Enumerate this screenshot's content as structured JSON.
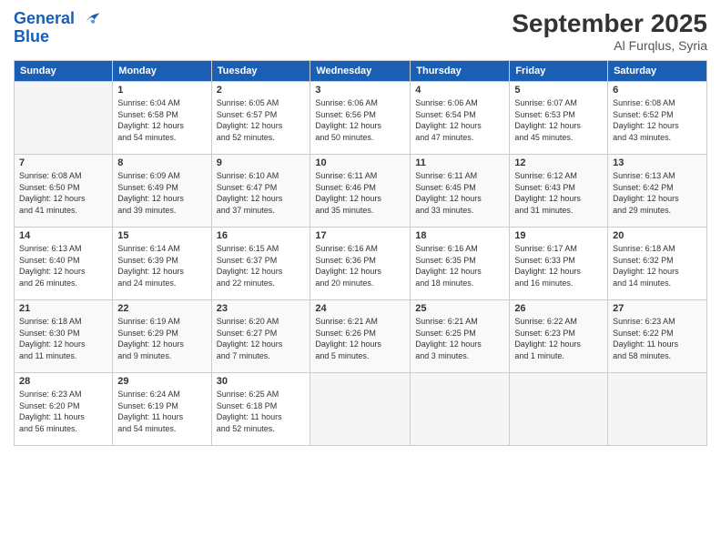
{
  "header": {
    "logo_line1": "General",
    "logo_line2": "Blue",
    "month": "September 2025",
    "location": "Al Furqlus, Syria"
  },
  "weekdays": [
    "Sunday",
    "Monday",
    "Tuesday",
    "Wednesday",
    "Thursday",
    "Friday",
    "Saturday"
  ],
  "weeks": [
    [
      {
        "day": "",
        "info": ""
      },
      {
        "day": "1",
        "info": "Sunrise: 6:04 AM\nSunset: 6:58 PM\nDaylight: 12 hours\nand 54 minutes."
      },
      {
        "day": "2",
        "info": "Sunrise: 6:05 AM\nSunset: 6:57 PM\nDaylight: 12 hours\nand 52 minutes."
      },
      {
        "day": "3",
        "info": "Sunrise: 6:06 AM\nSunset: 6:56 PM\nDaylight: 12 hours\nand 50 minutes."
      },
      {
        "day": "4",
        "info": "Sunrise: 6:06 AM\nSunset: 6:54 PM\nDaylight: 12 hours\nand 47 minutes."
      },
      {
        "day": "5",
        "info": "Sunrise: 6:07 AM\nSunset: 6:53 PM\nDaylight: 12 hours\nand 45 minutes."
      },
      {
        "day": "6",
        "info": "Sunrise: 6:08 AM\nSunset: 6:52 PM\nDaylight: 12 hours\nand 43 minutes."
      }
    ],
    [
      {
        "day": "7",
        "info": "Sunrise: 6:08 AM\nSunset: 6:50 PM\nDaylight: 12 hours\nand 41 minutes."
      },
      {
        "day": "8",
        "info": "Sunrise: 6:09 AM\nSunset: 6:49 PM\nDaylight: 12 hours\nand 39 minutes."
      },
      {
        "day": "9",
        "info": "Sunrise: 6:10 AM\nSunset: 6:47 PM\nDaylight: 12 hours\nand 37 minutes."
      },
      {
        "day": "10",
        "info": "Sunrise: 6:11 AM\nSunset: 6:46 PM\nDaylight: 12 hours\nand 35 minutes."
      },
      {
        "day": "11",
        "info": "Sunrise: 6:11 AM\nSunset: 6:45 PM\nDaylight: 12 hours\nand 33 minutes."
      },
      {
        "day": "12",
        "info": "Sunrise: 6:12 AM\nSunset: 6:43 PM\nDaylight: 12 hours\nand 31 minutes."
      },
      {
        "day": "13",
        "info": "Sunrise: 6:13 AM\nSunset: 6:42 PM\nDaylight: 12 hours\nand 29 minutes."
      }
    ],
    [
      {
        "day": "14",
        "info": "Sunrise: 6:13 AM\nSunset: 6:40 PM\nDaylight: 12 hours\nand 26 minutes."
      },
      {
        "day": "15",
        "info": "Sunrise: 6:14 AM\nSunset: 6:39 PM\nDaylight: 12 hours\nand 24 minutes."
      },
      {
        "day": "16",
        "info": "Sunrise: 6:15 AM\nSunset: 6:37 PM\nDaylight: 12 hours\nand 22 minutes."
      },
      {
        "day": "17",
        "info": "Sunrise: 6:16 AM\nSunset: 6:36 PM\nDaylight: 12 hours\nand 20 minutes."
      },
      {
        "day": "18",
        "info": "Sunrise: 6:16 AM\nSunset: 6:35 PM\nDaylight: 12 hours\nand 18 minutes."
      },
      {
        "day": "19",
        "info": "Sunrise: 6:17 AM\nSunset: 6:33 PM\nDaylight: 12 hours\nand 16 minutes."
      },
      {
        "day": "20",
        "info": "Sunrise: 6:18 AM\nSunset: 6:32 PM\nDaylight: 12 hours\nand 14 minutes."
      }
    ],
    [
      {
        "day": "21",
        "info": "Sunrise: 6:18 AM\nSunset: 6:30 PM\nDaylight: 12 hours\nand 11 minutes."
      },
      {
        "day": "22",
        "info": "Sunrise: 6:19 AM\nSunset: 6:29 PM\nDaylight: 12 hours\nand 9 minutes."
      },
      {
        "day": "23",
        "info": "Sunrise: 6:20 AM\nSunset: 6:27 PM\nDaylight: 12 hours\nand 7 minutes."
      },
      {
        "day": "24",
        "info": "Sunrise: 6:21 AM\nSunset: 6:26 PM\nDaylight: 12 hours\nand 5 minutes."
      },
      {
        "day": "25",
        "info": "Sunrise: 6:21 AM\nSunset: 6:25 PM\nDaylight: 12 hours\nand 3 minutes."
      },
      {
        "day": "26",
        "info": "Sunrise: 6:22 AM\nSunset: 6:23 PM\nDaylight: 12 hours\nand 1 minute."
      },
      {
        "day": "27",
        "info": "Sunrise: 6:23 AM\nSunset: 6:22 PM\nDaylight: 11 hours\nand 58 minutes."
      }
    ],
    [
      {
        "day": "28",
        "info": "Sunrise: 6:23 AM\nSunset: 6:20 PM\nDaylight: 11 hours\nand 56 minutes."
      },
      {
        "day": "29",
        "info": "Sunrise: 6:24 AM\nSunset: 6:19 PM\nDaylight: 11 hours\nand 54 minutes."
      },
      {
        "day": "30",
        "info": "Sunrise: 6:25 AM\nSunset: 6:18 PM\nDaylight: 11 hours\nand 52 minutes."
      },
      {
        "day": "",
        "info": ""
      },
      {
        "day": "",
        "info": ""
      },
      {
        "day": "",
        "info": ""
      },
      {
        "day": "",
        "info": ""
      }
    ]
  ]
}
